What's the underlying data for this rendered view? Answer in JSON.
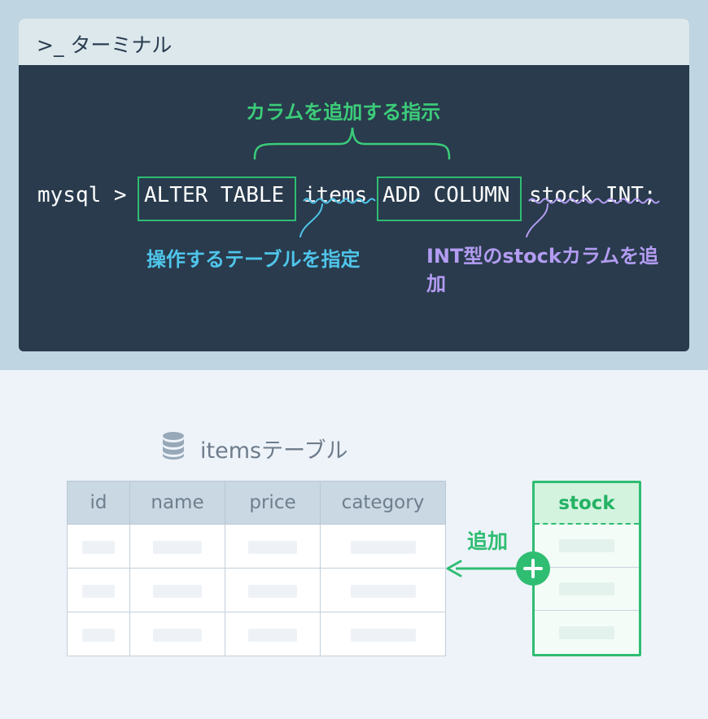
{
  "terminal": {
    "title": ">_ ターミナル",
    "prompt": "mysql >",
    "cmd_alter": "ALTER TABLE",
    "cmd_items": "items",
    "cmd_add": "ADD COLUMN",
    "cmd_rest": "stock INT;",
    "annotation_top": "カラムを追加する指示",
    "annotation_table": "操作するテーブルを指定",
    "annotation_column": "INT型のstockカラムを追加"
  },
  "table": {
    "title": "itemsテーブル",
    "headers": [
      "id",
      "name",
      "price",
      "category"
    ],
    "row_count": 3,
    "new_column": "stock",
    "add_label": "追加"
  },
  "colors": {
    "green": "#2fbd72",
    "blue": "#4fc5ea",
    "purple": "#b39cf2",
    "terminal_bg": "#293b4d"
  },
  "icons": [
    "database-icon",
    "plus-icon",
    "arrow-left-icon"
  ]
}
